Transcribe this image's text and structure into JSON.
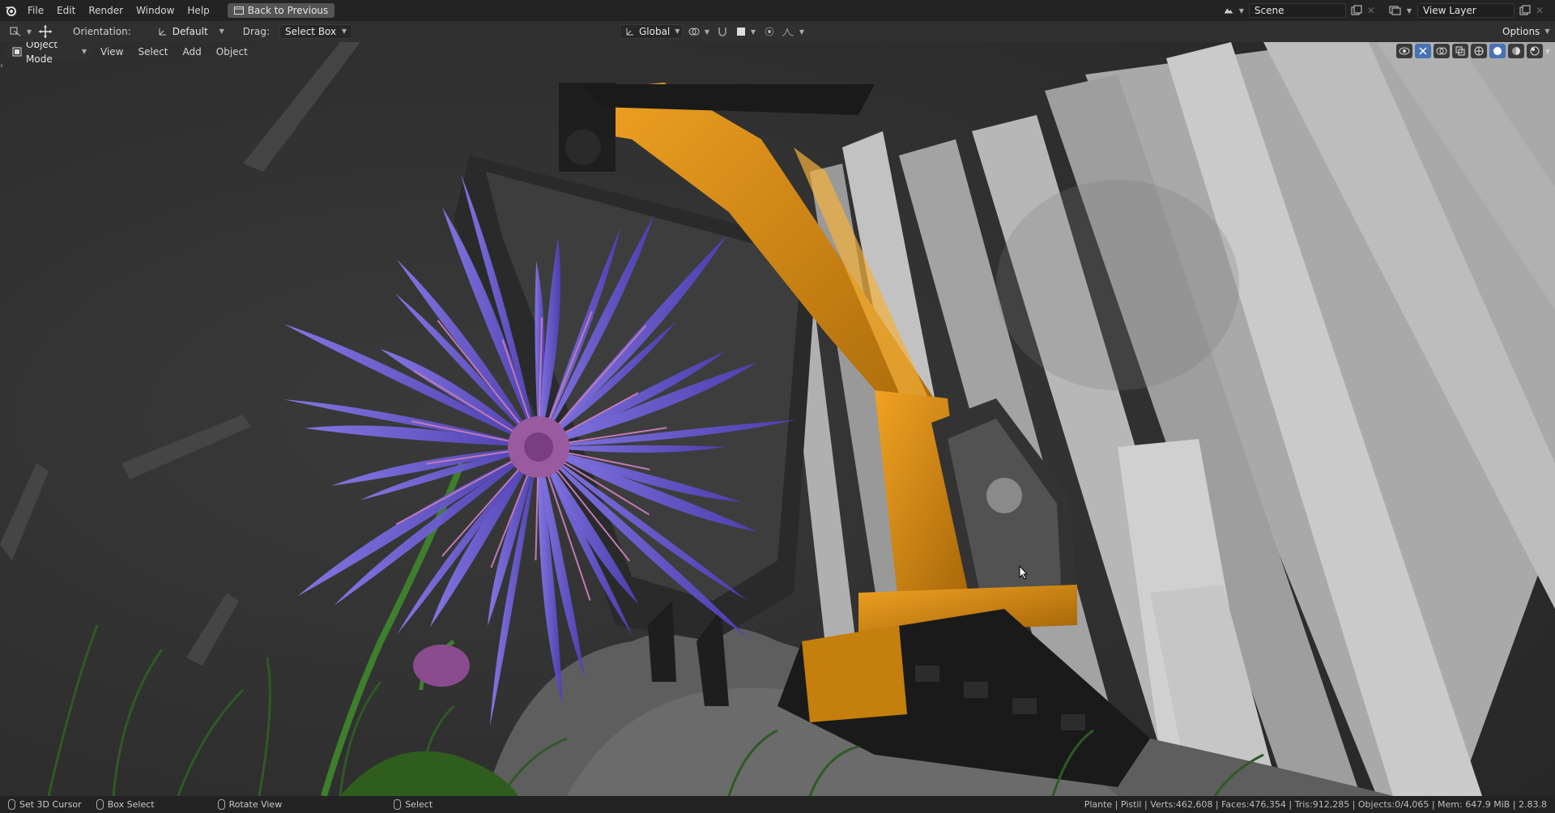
{
  "topbar": {
    "logo_icon": "blender-logo-icon",
    "menus": [
      "File",
      "Edit",
      "Render",
      "Window",
      "Help"
    ],
    "back_button": "Back to Previous",
    "scene": {
      "label": "Scene",
      "icon": "scene-icon"
    },
    "view_layer": {
      "label": "View Layer",
      "icon": "view-layer-icon"
    }
  },
  "toolbar": {
    "orientation_label": "Orientation:",
    "orientation_value": "Default",
    "drag_label": "Drag:",
    "drag_value": "Select Box",
    "transform_orientation": "Global",
    "options_label": "Options"
  },
  "viewport_header": {
    "mode": "Object Mode",
    "menus": [
      "View",
      "Select",
      "Add",
      "Object"
    ]
  },
  "statusbar": {
    "items": [
      {
        "icon": "mouse-left-icon",
        "label": "Set 3D Cursor"
      },
      {
        "icon": "mouse-middle-icon",
        "label": "Box Select"
      },
      {
        "icon": "mouse-right-icon",
        "label": "Rotate View"
      },
      {
        "icon": "mouse-left-icon",
        "label": "Select"
      }
    ],
    "stats": "Plante | Pistil | Verts:462,608 | Faces:476,354 | Tris:912,285 | Objects:0/4,065 | Mem: 647.9 MiB | 2.83.8"
  },
  "colors": {
    "accent": "#4772b3",
    "header_bg": "#232323",
    "toolbar_bg": "#303030",
    "excavator_orange": "#d08a10",
    "flower_purple": "#6e5fd6"
  }
}
